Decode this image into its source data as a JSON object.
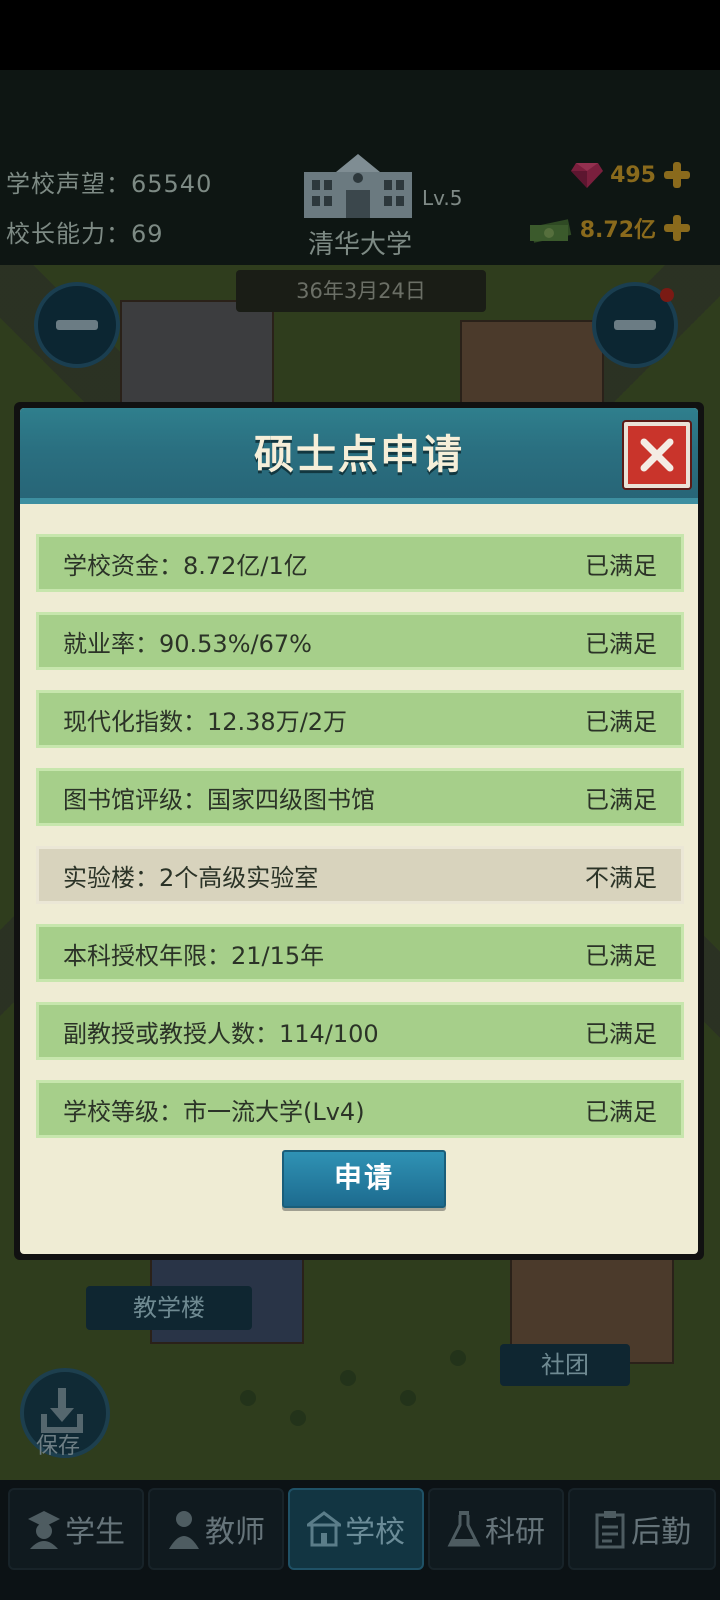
{
  "top": {
    "reputation_label": "学校声望：",
    "reputation_value": "65540",
    "ability_label": "校长能力：",
    "ability_value": "69",
    "school_level": "Lv.5",
    "school_name": "清华大学",
    "gems": "495",
    "money": "8.72亿",
    "date": "36年3月24日"
  },
  "map_labels": {
    "teaching_building": "教学楼",
    "club": "社团",
    "save": "保存"
  },
  "modal": {
    "title": "硕士点申请",
    "rows": [
      {
        "text": "学校资金：8.72亿/1亿",
        "status": "已满足"
      },
      {
        "text": "就业率：90.53%/67%",
        "status": "已满足"
      },
      {
        "text": "现代化指数：12.38万/2万",
        "status": "已满足"
      },
      {
        "text": "图书馆评级：国家四级图书馆",
        "status": "已满足"
      },
      {
        "text": "实验楼：2个高级实验室",
        "status": "不满足"
      },
      {
        "text": "本科授权年限：21/15年",
        "status": "已满足"
      },
      {
        "text": "副教授或教授人数：114/100",
        "status": "已满足"
      },
      {
        "text": "学校等级：市一流大学(Lv4)",
        "status": "已满足"
      }
    ],
    "apply_label": "申请"
  },
  "nav": {
    "tabs": [
      {
        "label": "学生",
        "icon": "student-icon"
      },
      {
        "label": "教师",
        "icon": "teacher-icon"
      },
      {
        "label": "学校",
        "icon": "school-icon",
        "active": true
      },
      {
        "label": "科研",
        "icon": "flask-icon"
      },
      {
        "label": "后勤",
        "icon": "clipboard-icon"
      }
    ]
  },
  "colors": {
    "satisfied_row": "#a6cf8a",
    "unsatisfied_row": "#d8d3bd",
    "header_teal": "#2a6f80",
    "close_red": "#c9342b",
    "apply_blue": "#1d6b8f"
  }
}
